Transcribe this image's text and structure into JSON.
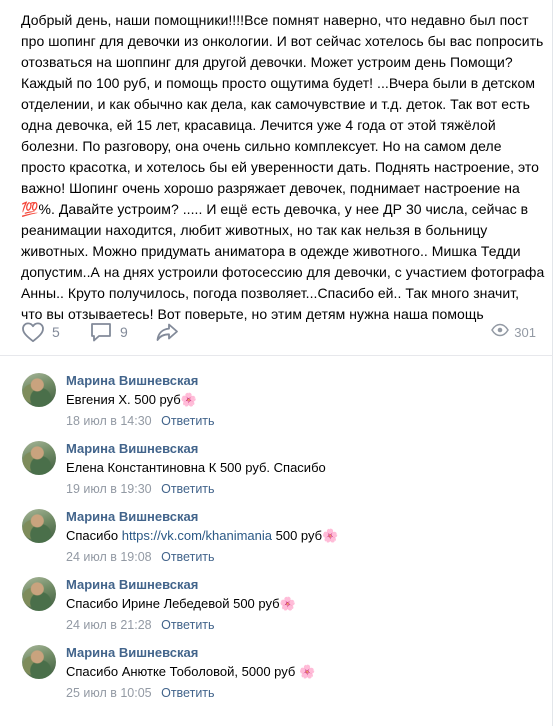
{
  "post": {
    "lines": [
      "Добрый день, наши помощники!!!!Все помнят наверно, что недавно был пост",
      "про шопинг для девочки из онкологии. И вот сейчас хотелось бы вас попросить",
      "отозваться на шоппинг для другой девочки. Может устроим день Помощи?",
      "Каждый по 100 руб, и помощь просто ощутима будет! ...Вчера были в детском",
      "отделении, и как обычно как дела, как самочувствие и т.д. деток. Так вот есть",
      "одна девочка, ей 15 лет, красавица. Лечится уже 4 года от этой тяжёлой",
      "болезни. По разговору, она очень сильно комплексует. Но на самом деле",
      "просто красотка, и хотелось бы ей уверенности дать. Поднять настроение, это",
      "важно! Шопинг очень хорошо разряжает девочек, поднимает настроение на",
      "💯%. Давайте устроим? ..... И ещё есть девочка, у нее ДР 30 числа, сейчас в",
      "реанимации находится, любит животных, но так как нельзя в больницу",
      "животных. Можно придумать аниматора в одежде животного.. Мишка Тедди",
      "допустим..А на днях устроили фотосессию для девочки, с участием фотографа",
      "Анны.. Круто получилось, погода позволяет...Спасибо ей.. Так много значит,",
      "что вы отзываетесь! Вот поверьте, но этим детям нужна наша помощь"
    ],
    "likes": "5",
    "comments": "9",
    "views": "301"
  },
  "comments": [
    {
      "author": "Марина Вишневская",
      "text": "Евгения Х. 500 руб🌸",
      "date": "18 июл в 14:30",
      "reply": "Ответить"
    },
    {
      "author": "Марина Вишневская",
      "text": "Елена Константиновна К 500 руб. Спасибо",
      "date": "19 июл в 19:30",
      "reply": "Ответить"
    },
    {
      "author": "Марина Вишневская",
      "text_before": "Спасибо ",
      "link": "https://vk.com/khanimania",
      "text_after": " 500 руб🌸",
      "date": "24 июл в 19:08",
      "reply": "Ответить"
    },
    {
      "author": "Марина Вишневская",
      "text": "Спасибо Ирине Лебедевой 500 руб🌸",
      "date": "24 июл в 21:28",
      "reply": "Ответить"
    },
    {
      "author": "Марина Вишневская",
      "text": "Спасибо Анютке Тоболовой, 5000 руб 🌸",
      "date": "25 июл в 10:05",
      "reply": "Ответить"
    }
  ],
  "icons": {
    "like": "heart-icon",
    "comment": "speech-bubble-icon",
    "share": "share-arrow-icon",
    "views": "eye-icon"
  },
  "colors": {
    "link": "#2a5885",
    "author": "#42648b",
    "muted": "#828a99"
  }
}
